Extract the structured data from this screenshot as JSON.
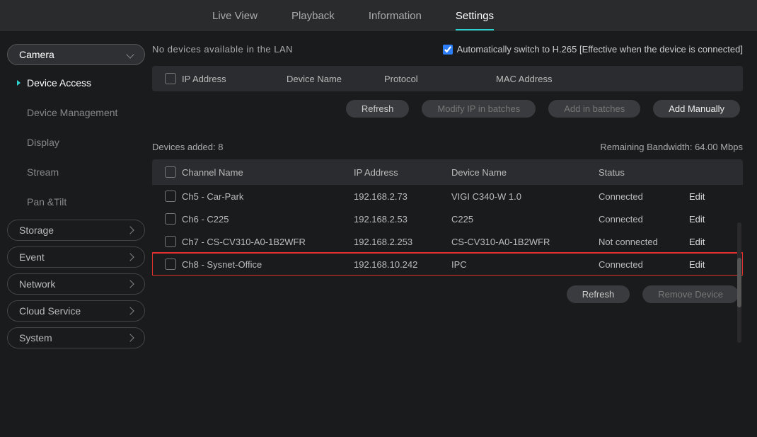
{
  "topnav": {
    "live_view": "Live View",
    "playback": "Playback",
    "information": "Information",
    "settings": "Settings"
  },
  "sidebar": {
    "camera": "Camera",
    "camera_items": {
      "device_access": "Device Access",
      "device_management": "Device Management",
      "display": "Display",
      "stream": "Stream",
      "pan_tilt": "Pan &Tilt"
    },
    "storage": "Storage",
    "event": "Event",
    "network": "Network",
    "cloud_service": "Cloud Service",
    "system": "System"
  },
  "lan": {
    "empty_msg": "No devices available in the LAN",
    "auto_switch_label": "Automatically switch to H.265 [Effective when the device is connected]",
    "headers": {
      "ip": "IP Address",
      "device": "Device Name",
      "protocol": "Protocol",
      "mac": "MAC Address"
    },
    "buttons": {
      "refresh": "Refresh",
      "modify_batch": "Modify IP in batches",
      "add_batch": "Add in batches",
      "add_manual": "Add Manually"
    }
  },
  "added": {
    "title": "Devices added: 8",
    "bandwidth": "Remaining Bandwidth: 64.00 Mbps",
    "headers": {
      "channel": "Channel Name",
      "ip": "IP Address",
      "device": "Device Name",
      "status": "Status"
    },
    "rows": [
      {
        "channel": "Ch5 - Car-Park",
        "ip": "192.168.2.73",
        "device": "VIGI C340-W 1.0",
        "status": "Connected",
        "edit": "Edit",
        "hl": false
      },
      {
        "channel": "Ch6 - C225",
        "ip": "192.168.2.53",
        "device": "C225",
        "status": "Connected",
        "edit": "Edit",
        "hl": false
      },
      {
        "channel": "Ch7 - CS-CV310-A0-1B2WFR",
        "ip": "192.168.2.253",
        "device": "CS-CV310-A0-1B2WFR",
        "status": "Not connected",
        "edit": "Edit",
        "hl": false
      },
      {
        "channel": "Ch8 - Sysnet-Office",
        "ip": "192.168.10.242",
        "device": "IPC",
        "status": "Connected",
        "edit": "Edit",
        "hl": true
      }
    ],
    "footer": {
      "refresh": "Refresh",
      "remove": "Remove Device"
    }
  }
}
